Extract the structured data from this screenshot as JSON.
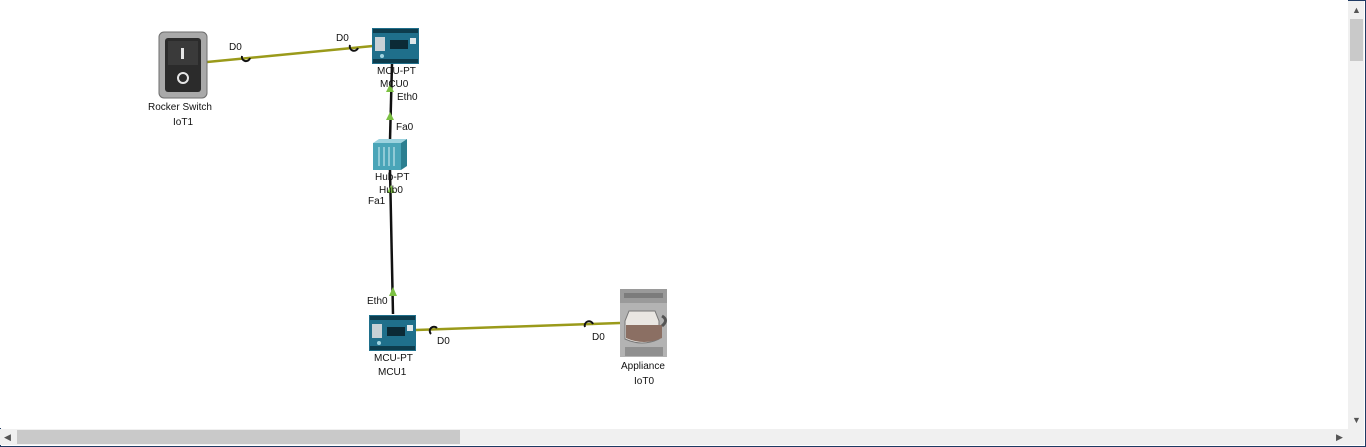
{
  "devices": {
    "rocker": {
      "name": "Rocker Switch",
      "id": "IoT1"
    },
    "mcu0": {
      "name": "MCU-PT",
      "id": "MCU0"
    },
    "hub": {
      "name": "Hub-PT",
      "id": "Hub0"
    },
    "mcu1": {
      "name": "MCU-PT",
      "id": "MCU1"
    },
    "appliance": {
      "name": "Appliance",
      "id": "IoT0"
    }
  },
  "ports": {
    "rocker_d0": "D0",
    "mcu0_d0": "D0",
    "mcu0_eth0": "Eth0",
    "hub_fa0": "Fa0",
    "hub_fa1": "Fa1",
    "mcu1_eth0": "Eth0",
    "mcu1_d0": "D0",
    "appliance_d0": "D0"
  },
  "colors": {
    "iot_wire": "#9a9a1a",
    "eth_wire": "#111111",
    "link_up": "#7cc043",
    "window_border": "#1f3a63"
  },
  "scrollbar": {
    "up": "▲",
    "down": "▼",
    "left": "◀",
    "right": "▶"
  }
}
